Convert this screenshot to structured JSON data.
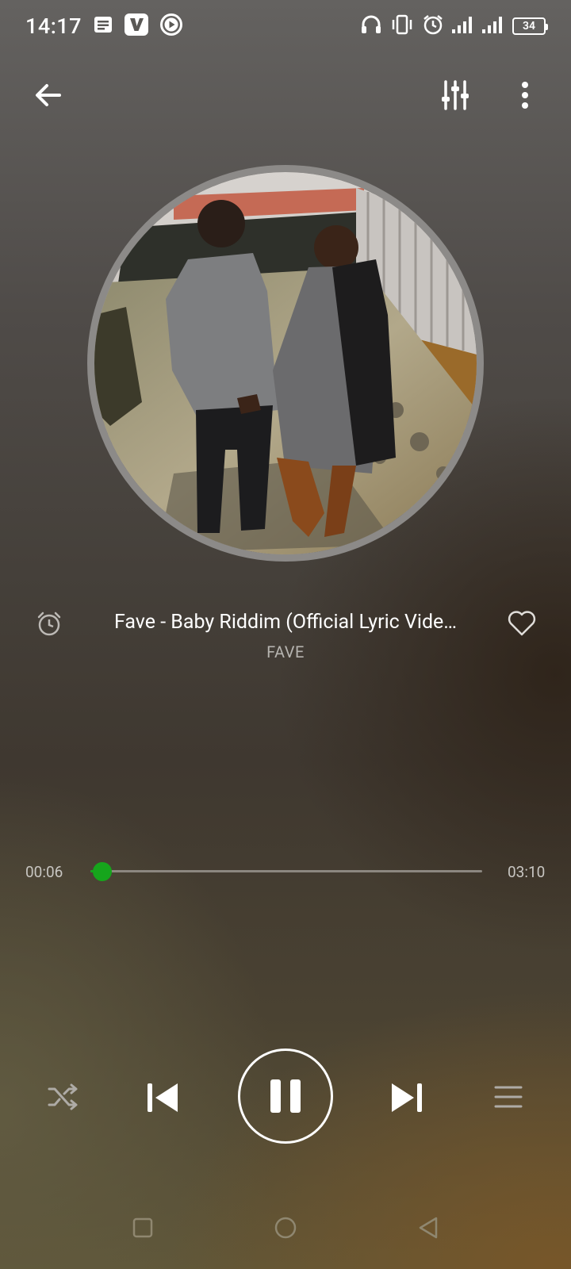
{
  "status_bar": {
    "time": "14:17",
    "battery": "34",
    "icons": [
      "notes-icon",
      "v-app-icon",
      "play-circle-icon",
      "headphones-icon",
      "vibrate-icon",
      "alarm-icon",
      "signal-icon",
      "signal-icon-2",
      "battery-icon"
    ]
  },
  "top_bar": {
    "back_icon": "arrow-left-icon",
    "equalizer_icon": "equalizer-icon",
    "more_icon": "more-vertical-icon"
  },
  "track": {
    "title": "Fave - Baby Riddim (Official Lyric Vide…",
    "artist": "FAVE",
    "sleep_timer_icon": "alarm-clock-icon",
    "favorite_icon": "heart-outline-icon"
  },
  "progress": {
    "elapsed": "00:06",
    "total": "03:10",
    "fraction": 0.03,
    "accent_color": "#16a51c"
  },
  "controls": {
    "shuffle_icon": "shuffle-icon",
    "previous_icon": "skip-previous-icon",
    "play_state_icon": "pause-icon",
    "next_icon": "skip-next-icon",
    "queue_icon": "queue-list-icon"
  },
  "nav_bar": {
    "icons": [
      "recents-square-icon",
      "home-circle-icon",
      "back-triangle-icon"
    ]
  }
}
